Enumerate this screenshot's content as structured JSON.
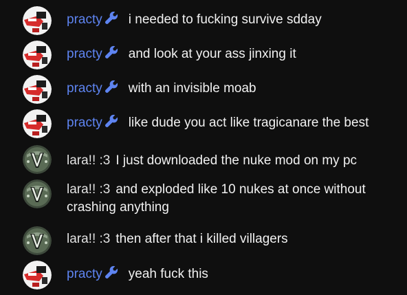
{
  "colors": {
    "background": "#0f0f0f",
    "moderator_name": "#5e84f1",
    "member_name": "#e1e1e1",
    "message_text": "#f1f1f1"
  },
  "messages": [
    {
      "author": "practy",
      "role": "moderator",
      "badge_icon": "wrench-icon",
      "avatar": "red-white-avatar",
      "text": "i needed to fucking survive sdday"
    },
    {
      "author": "practy",
      "role": "moderator",
      "badge_icon": "wrench-icon",
      "avatar": "red-white-avatar",
      "text": "and look at your ass jinxing it"
    },
    {
      "author": "practy",
      "role": "moderator",
      "badge_icon": "wrench-icon",
      "avatar": "red-white-avatar",
      "text": "with an invisible moab"
    },
    {
      "author": "practy",
      "role": "moderator",
      "badge_icon": "wrench-icon",
      "avatar": "red-white-avatar",
      "text": "like dude you act like tragicanare the best"
    },
    {
      "author": "lara!! :3",
      "role": "member",
      "avatar": "green-v-avatar",
      "text": "I just downloaded the nuke mod on my pc"
    },
    {
      "author": "lara!! :3",
      "role": "member",
      "avatar": "green-v-avatar",
      "text": "and exploded like 10 nukes at once without crashing anything"
    },
    {
      "author": "lara!! :3",
      "role": "member",
      "avatar": "green-v-avatar",
      "text": "then after that i killed villagers"
    },
    {
      "author": "practy",
      "role": "moderator",
      "badge_icon": "wrench-icon",
      "avatar": "red-white-avatar",
      "text": "yeah fuck this"
    }
  ]
}
